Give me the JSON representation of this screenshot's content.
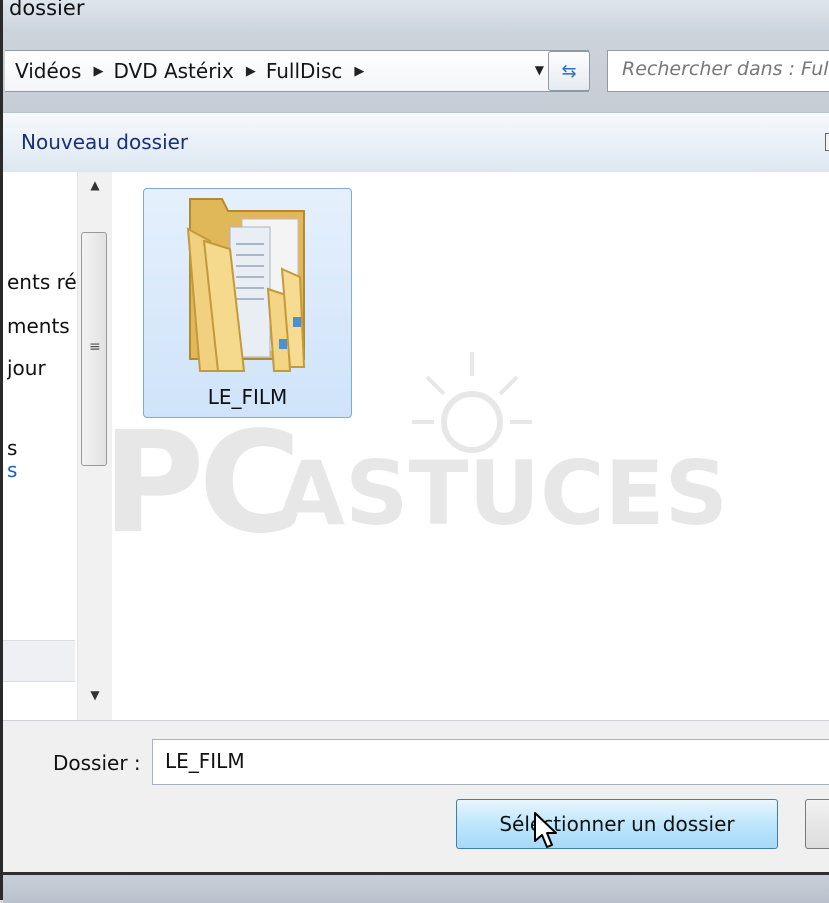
{
  "window": {
    "title": "dossier"
  },
  "address_bar": {
    "breadcrumbs": [
      "Vidéos",
      "DVD Astérix",
      "FullDisc"
    ],
    "search_placeholder": "Rechercher dans : FullDisc"
  },
  "toolbar": {
    "new_folder_label": "Nouveau dossier"
  },
  "nav_pane": {
    "items": [
      {
        "label": "ents ré"
      },
      {
        "label": "ments"
      },
      {
        "label": "jour"
      },
      {
        "label": "s"
      },
      {
        "label": "s"
      }
    ]
  },
  "content": {
    "items": [
      {
        "name": "LE_FILM",
        "type": "folder",
        "selected": true
      }
    ],
    "watermark": {
      "line1": "PC",
      "line2": "ASTUCES"
    }
  },
  "bottom": {
    "folder_label": "Dossier :",
    "folder_value": "LE_FILM",
    "select_button": "Sélectionner un dossier"
  }
}
